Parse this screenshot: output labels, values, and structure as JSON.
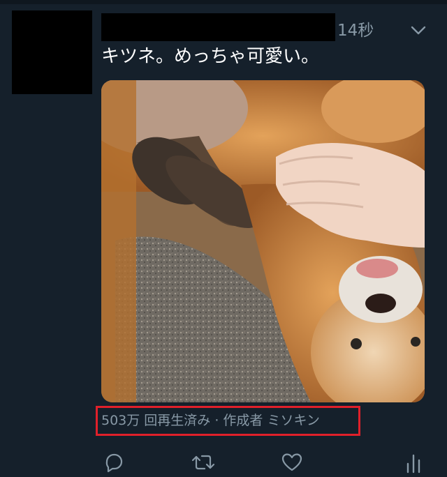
{
  "tweet": {
    "timestamp": "14秒",
    "text": "キツネ。めっちゃ可愛い。",
    "media_description": "video thumbnail",
    "views_label": "503万 回再生済み · 作成者 ミソキン"
  },
  "icons": {
    "caret": "chevron-down-icon",
    "reply": "reply-icon",
    "retweet": "retweet-icon",
    "like": "heart-icon",
    "analytics": "analytics-icon"
  },
  "colors": {
    "background": "#15202b",
    "secondary_text": "#8899a6",
    "highlight_border": "#e0202a"
  }
}
